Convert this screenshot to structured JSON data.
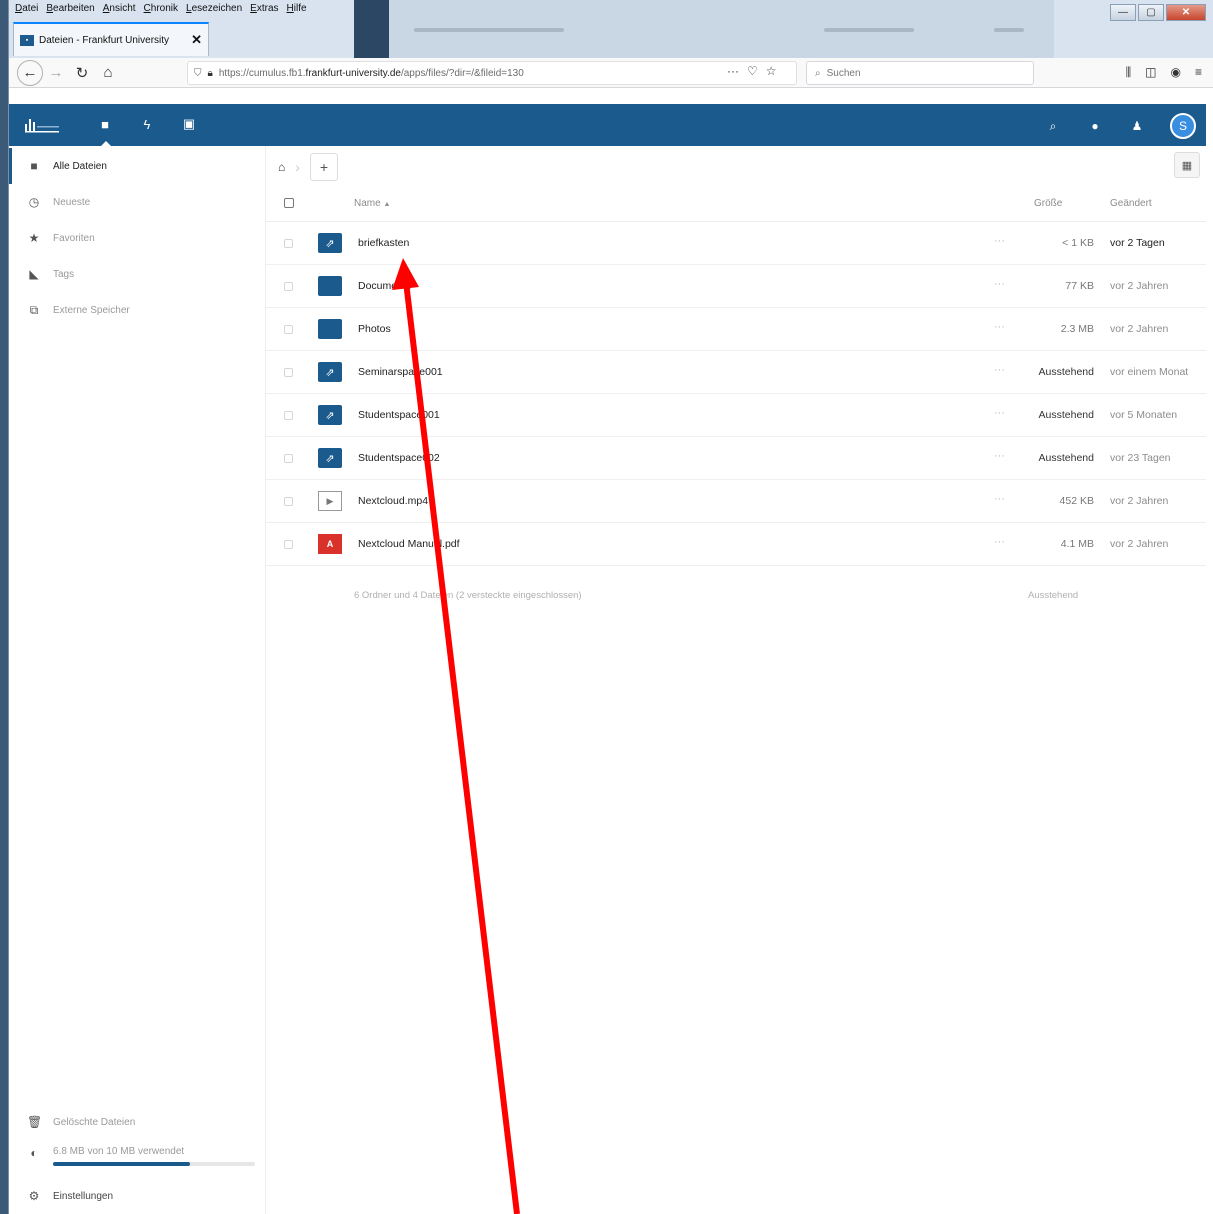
{
  "browser": {
    "menu": [
      "Datei",
      "Bearbeiten",
      "Ansicht",
      "Chronik",
      "Lesezeichen",
      "Extras",
      "Hilfe"
    ],
    "tab_title": "Dateien - Frankfurt University",
    "tab_close": "✕",
    "url_prefix": "https://cumulus.fb1.",
    "url_domain": "frankfurt-university.de",
    "url_suffix": "/apps/files/?dir=/&fileid=130",
    "search_placeholder": "Suchen",
    "window_controls": [
      "—",
      "▢",
      "✕"
    ]
  },
  "header": {
    "apps": [
      {
        "icon": "folder-icon",
        "glyph": "■"
      },
      {
        "icon": "activity-icon",
        "glyph": "ϟ"
      },
      {
        "icon": "gallery-icon",
        "glyph": "▣"
      }
    ],
    "avatar_letter": "S"
  },
  "sidebar": {
    "items": [
      {
        "label": "Alle Dateien",
        "icon": "folder-icon",
        "glyph": "■"
      },
      {
        "label": "Neueste",
        "icon": "clock-icon",
        "glyph": "◷"
      },
      {
        "label": "Favoriten",
        "icon": "star-icon",
        "glyph": "★"
      },
      {
        "label": "Tags",
        "icon": "tag-icon",
        "glyph": "◣"
      },
      {
        "label": "Externe Speicher",
        "icon": "external-storage-icon",
        "glyph": "⧉"
      }
    ],
    "deleted_label": "Gelöschte Dateien",
    "quota_label": "6.8 MB von 10 MB verwendet",
    "quota_fraction": 0.68,
    "settings_label": "Einstellungen"
  },
  "files": {
    "columns": {
      "name": "Name",
      "size": "Größe",
      "modified": "Geändert"
    },
    "sort_indicator": "▲",
    "rows": [
      {
        "name": "briefkasten",
        "type": "shared",
        "size": "< 1 KB",
        "modified": "vor 2 Tagen"
      },
      {
        "name": "Documents",
        "type": "folder",
        "size": "77 KB",
        "modified": "vor 2 Jahren"
      },
      {
        "name": "Photos",
        "type": "folder",
        "size": "2.3 MB",
        "modified": "vor 2 Jahren"
      },
      {
        "name": "Seminarspace001",
        "type": "shared",
        "size": "Ausstehend",
        "modified": "vor einem Monat"
      },
      {
        "name": "Studentspace001",
        "type": "shared",
        "size": "Ausstehend",
        "modified": "vor 5 Monaten"
      },
      {
        "name": "Studentspace002",
        "type": "shared",
        "size": "Ausstehend",
        "modified": "vor 23 Tagen"
      },
      {
        "name": "Nextcloud.mp4",
        "type": "video",
        "size": "452 KB",
        "modified": "vor 2 Jahren"
      },
      {
        "name": "Nextcloud Manual.pdf",
        "type": "pdf",
        "size": "4.1 MB",
        "modified": "vor 2 Jahren"
      }
    ],
    "summary_text": "6 Ordner und 4 Dateien (2 versteckte eingeschlossen)",
    "summary_size": "Ausstehend"
  },
  "colors": {
    "brand": "#1b5a8c",
    "arrow": "#ff0000"
  }
}
